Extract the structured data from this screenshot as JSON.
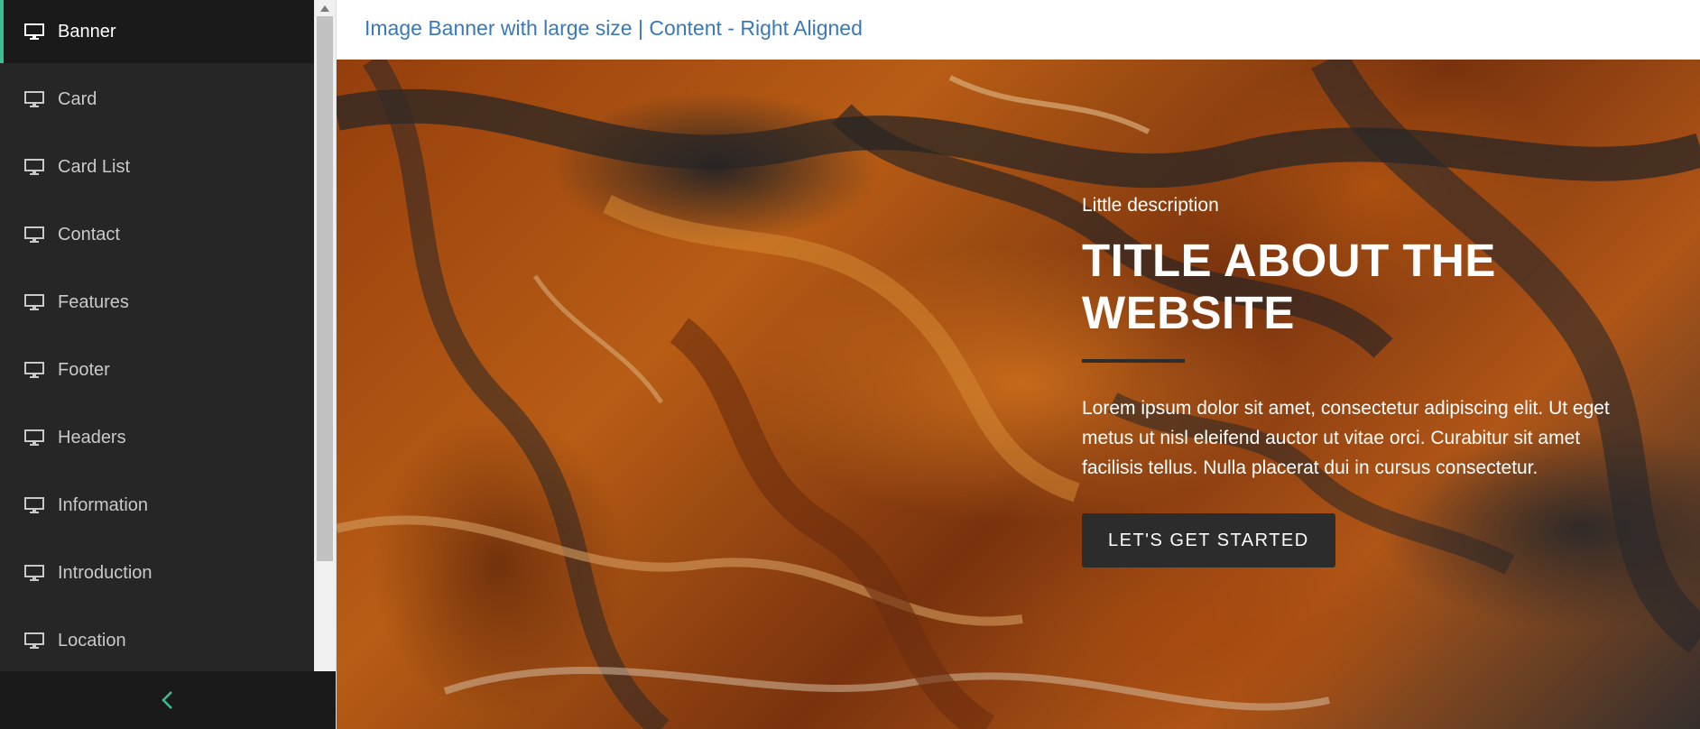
{
  "sidebar": {
    "items": [
      {
        "label": "Banner",
        "icon": "monitor-icon",
        "active": true
      },
      {
        "label": "Card",
        "icon": "monitor-icon"
      },
      {
        "label": "Card List",
        "icon": "monitor-icon"
      },
      {
        "label": "Contact",
        "icon": "monitor-icon"
      },
      {
        "label": "Features",
        "icon": "monitor-icon"
      },
      {
        "label": "Footer",
        "icon": "monitor-icon"
      },
      {
        "label": "Headers",
        "icon": "monitor-icon"
      },
      {
        "label": "Information",
        "icon": "monitor-icon"
      },
      {
        "label": "Introduction",
        "icon": "monitor-icon"
      },
      {
        "label": "Location",
        "icon": "monitor-icon"
      }
    ],
    "collapse_icon": "chevron-left-icon",
    "active_accent": "#3dbd93"
  },
  "main": {
    "title": "Image Banner with large size | Content - Right Aligned",
    "title_color": "#3a78b7"
  },
  "banner": {
    "eyebrow": "Little description",
    "headline_line1": "TITLE ABOUT THE",
    "headline_line2": "WEBSITE",
    "body": "Lorem ipsum dolor sit amet, consectetur adipiscing elit. Ut eget metus ut nisl eleifend auctor ut vitae orci. Curabitur sit amet facilisis tellus. Nulla placerat dui in cursus consectetur.",
    "cta_label": "LET'S GET STARTED"
  }
}
